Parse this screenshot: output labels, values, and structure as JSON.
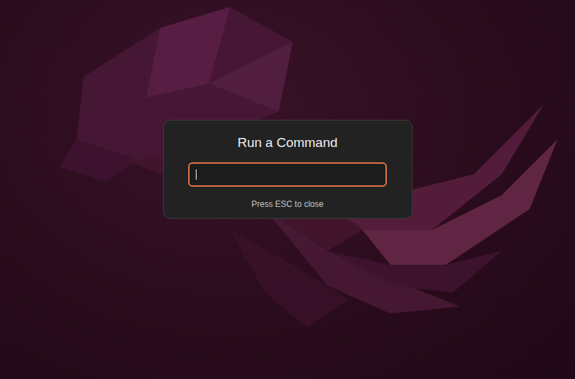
{
  "dialog": {
    "title": "Run a Command",
    "input": {
      "value": "",
      "focused": true
    },
    "hint": "Press ESC to close"
  }
}
